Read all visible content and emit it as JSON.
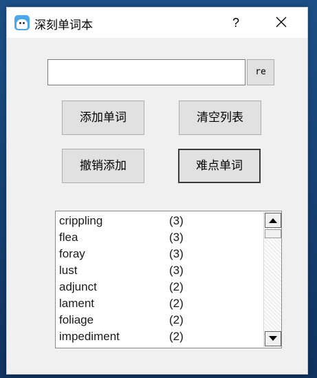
{
  "window": {
    "title": "深刻单词本",
    "help_label": "?",
    "icon": "notebook-app-icon",
    "close_icon": "close-icon"
  },
  "input": {
    "value": "",
    "button_label": "re"
  },
  "buttons": {
    "add_word": "添加单词",
    "clear_list": "清空列表",
    "undo_add": "撤销添加",
    "hard_words": "难点单词"
  },
  "list": {
    "items": [
      {
        "word": "crippling",
        "count": "(3)"
      },
      {
        "word": "flea",
        "count": "(3)"
      },
      {
        "word": "foray",
        "count": "(3)"
      },
      {
        "word": "lust",
        "count": "(3)"
      },
      {
        "word": "adjunct",
        "count": "(2)"
      },
      {
        "word": "lament",
        "count": "(2)"
      },
      {
        "word": "foliage",
        "count": "(2)"
      },
      {
        "word": "impediment",
        "count": "(2)"
      }
    ]
  },
  "scrollbar": {
    "up_icon": "arrow-up-icon",
    "down_icon": "arrow-down-icon",
    "position": 0
  }
}
